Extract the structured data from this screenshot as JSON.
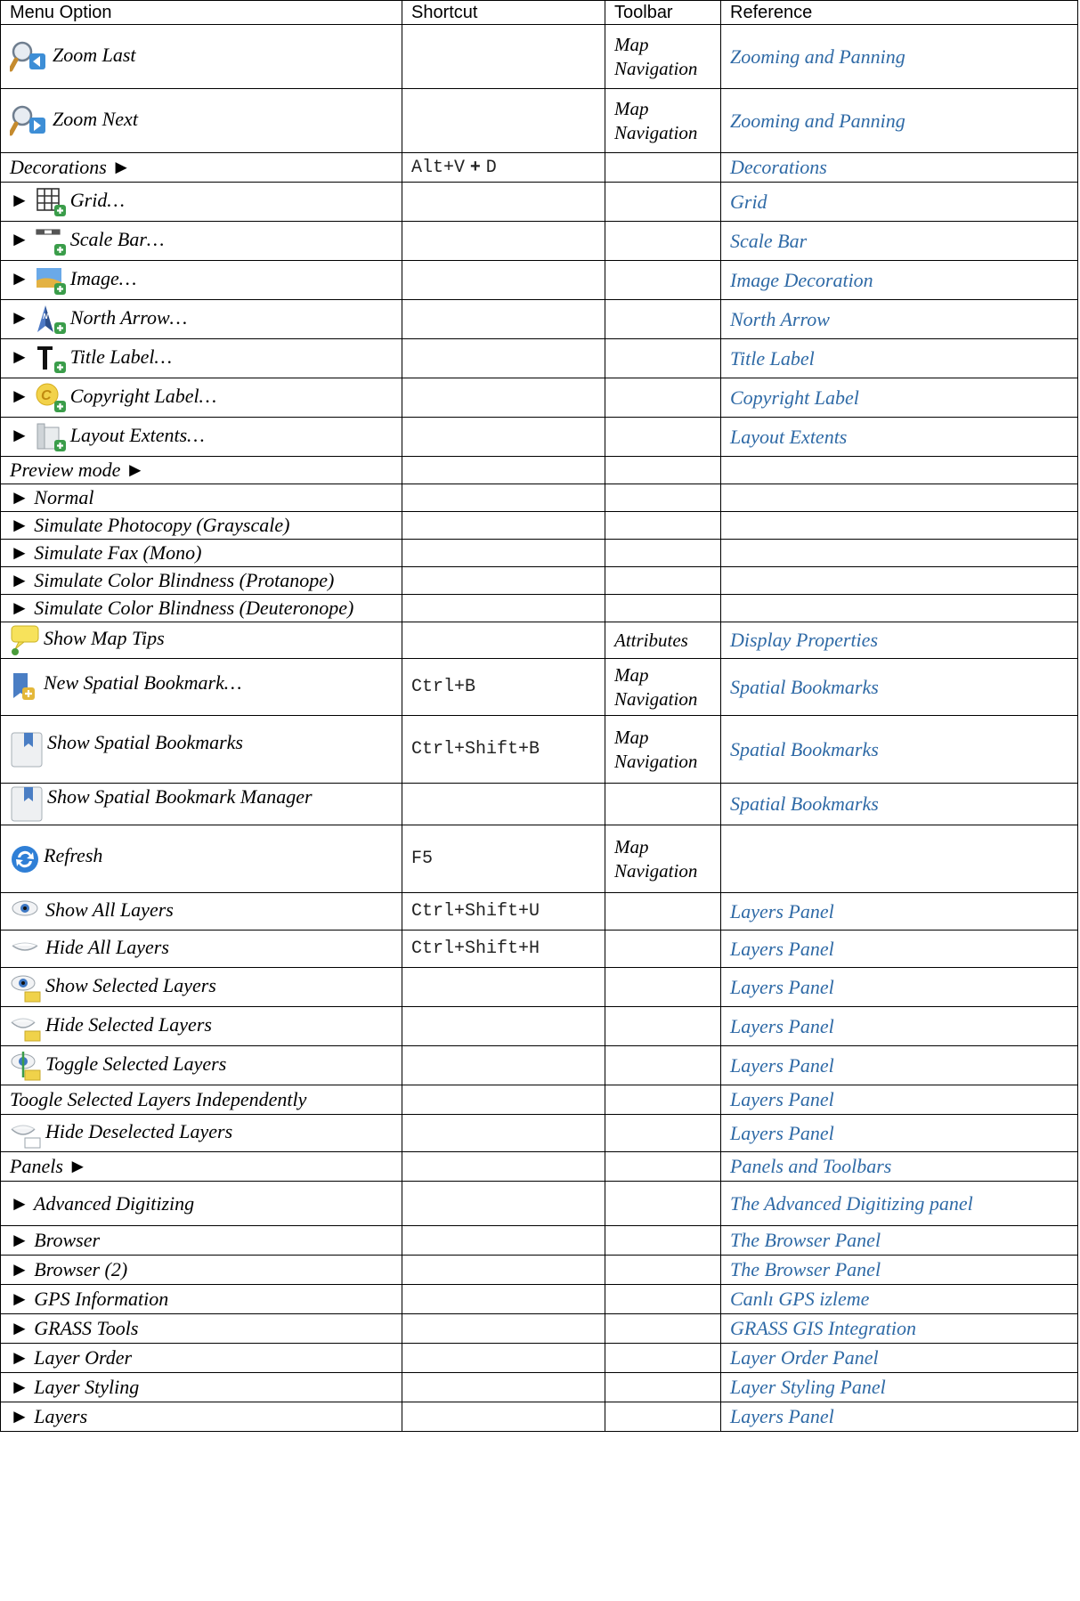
{
  "header": {
    "menu_option": "Menu Option",
    "shortcut": "Shortcut",
    "toolbar": "Toolbar",
    "reference": "Reference"
  },
  "rows": [
    {
      "label": "Zoom Last",
      "icon": "zoom-last-icon",
      "shortcut": "",
      "toolbar": "Map Navigation",
      "reference": "Zooming and Panning"
    },
    {
      "label": "Zoom Next",
      "icon": "zoom-next-icon",
      "shortcut": "",
      "toolbar": "Map Navigation",
      "reference": "Zooming and Panning"
    },
    {
      "label": "Decorations ►",
      "shortcut_parts": [
        "Alt+V",
        "+",
        "D"
      ],
      "toolbar": "",
      "reference": "Decorations"
    },
    {
      "label": "Grid…",
      "prefix": "►",
      "icon": "grid-icon",
      "shortcut": "",
      "toolbar": "",
      "reference": "Grid"
    },
    {
      "label": "Scale Bar…",
      "prefix": "►",
      "icon": "scale-bar-icon",
      "shortcut": "",
      "toolbar": "",
      "reference": "Scale Bar"
    },
    {
      "label": "Image…",
      "prefix": "►",
      "icon": "image-icon",
      "shortcut": "",
      "toolbar": "",
      "reference": "Image Decoration"
    },
    {
      "label": "North Arrow…",
      "prefix": "►",
      "icon": "north-arrow-icon",
      "shortcut": "",
      "toolbar": "",
      "reference": "North Arrow"
    },
    {
      "label": "Title Label…",
      "prefix": "►",
      "icon": "title-label-icon",
      "shortcut": "",
      "toolbar": "",
      "reference": "Title Label"
    },
    {
      "label": "Copyright Label…",
      "prefix": "►",
      "icon": "copyright-label-icon",
      "shortcut": "",
      "toolbar": "",
      "reference": "Copyright Label"
    },
    {
      "label": "Layout Extents…",
      "prefix": "►",
      "icon": "layout-extents-icon",
      "shortcut": "",
      "toolbar": "",
      "reference": "Layout Extents"
    },
    {
      "label": "Preview mode ►",
      "shortcut": "",
      "toolbar": "",
      "reference": ""
    },
    {
      "label": "► Normal",
      "shortcut": "",
      "toolbar": "",
      "reference": ""
    },
    {
      "label": "► Simulate Photocopy (Grayscale)",
      "shortcut": "",
      "toolbar": "",
      "reference": ""
    },
    {
      "label": "► Simulate Fax (Mono)",
      "shortcut": "",
      "toolbar": "",
      "reference": ""
    },
    {
      "label": "► Simulate Color Blindness (Protanope)",
      "shortcut": "",
      "toolbar": "",
      "reference": ""
    },
    {
      "label": "► Simulate Color Blindness (Deuteronope)",
      "shortcut": "",
      "toolbar": "",
      "reference": ""
    },
    {
      "label": "Show Map Tips",
      "icon": "map-tips-icon",
      "shortcut": "",
      "toolbar": "Attributes",
      "reference": "Display Properties"
    },
    {
      "label": "New Spatial Bookmark…",
      "icon": "new-bookmark-icon",
      "shortcut": "Ctrl+B",
      "toolbar": "Map Navigation",
      "reference": "Spatial Bookmarks"
    },
    {
      "label": "Show Spatial Bookmarks",
      "icon": "bookmarks-icon",
      "shortcut": "Ctrl+Shift+B",
      "toolbar": "Map Navigation",
      "reference": "Spatial Bookmarks"
    },
    {
      "label": "Show Spatial Bookmark Manager",
      "icon": "bookmark-manager-icon",
      "shortcut": "",
      "toolbar": "",
      "reference": "Spatial Bookmarks"
    },
    {
      "label": "Refresh",
      "icon": "refresh-icon",
      "shortcut": "F5",
      "toolbar": "Map Navigation",
      "reference": ""
    },
    {
      "label": "Show All Layers",
      "icon": "show-all-layers-icon",
      "shortcut": "Ctrl+Shift+U",
      "toolbar": "",
      "reference": "Layers Panel"
    },
    {
      "label": "Hide All Layers",
      "icon": "hide-all-layers-icon",
      "shortcut": "Ctrl+Shift+H",
      "toolbar": "",
      "reference": "Layers Panel"
    },
    {
      "label": "Show Selected Layers",
      "icon": "show-selected-layers-icon",
      "shortcut": "",
      "toolbar": "",
      "reference": "Layers Panel"
    },
    {
      "label": "Hide Selected Layers",
      "icon": "hide-selected-layers-icon",
      "shortcut": "",
      "toolbar": "",
      "reference": "Layers Panel"
    },
    {
      "label": "Toggle Selected Layers",
      "icon": "toggle-selected-layers-icon",
      "shortcut": "",
      "toolbar": "",
      "reference": "Layers Panel"
    },
    {
      "label": "Toogle Selected Layers Independently",
      "shortcut": "",
      "toolbar": "",
      "reference": "Layers Panel"
    },
    {
      "label": "Hide Deselected Layers",
      "icon": "hide-deselected-layers-icon",
      "shortcut": "",
      "toolbar": "",
      "reference": "Layers Panel"
    },
    {
      "label": "Panels ►",
      "shortcut": "",
      "toolbar": "",
      "reference": "Panels and Toolbars"
    },
    {
      "label": "► Advanced Digitizing",
      "shortcut": "",
      "toolbar": "",
      "reference": "The Advanced Digitizing panel"
    },
    {
      "label": "► Browser",
      "shortcut": "",
      "toolbar": "",
      "reference": "The Browser Panel"
    },
    {
      "label": "► Browser (2)",
      "shortcut": "",
      "toolbar": "",
      "reference": "The Browser Panel"
    },
    {
      "label": "► GPS Information",
      "shortcut": "",
      "toolbar": "",
      "reference": "Canlı GPS izleme"
    },
    {
      "label": "► GRASS Tools",
      "shortcut": "",
      "toolbar": "",
      "reference": "GRASS GIS Integration"
    },
    {
      "label": "► Layer Order",
      "shortcut": "",
      "toolbar": "",
      "reference": "Layer Order Panel"
    },
    {
      "label": "► Layer Styling",
      "shortcut": "",
      "toolbar": "",
      "reference": "Layer Styling Panel"
    },
    {
      "label": "► Layers",
      "shortcut": "",
      "toolbar": "",
      "reference": "Layers Panel"
    }
  ]
}
